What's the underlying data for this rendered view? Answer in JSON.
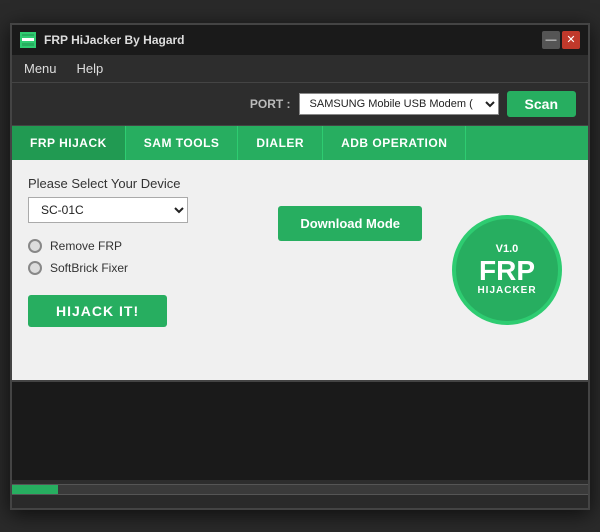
{
  "window": {
    "title": "FRP HiJacker By Hagard",
    "minimize_label": "—",
    "close_label": "✕"
  },
  "menu": {
    "items": [
      {
        "label": "Menu"
      },
      {
        "label": "Help"
      }
    ]
  },
  "port_bar": {
    "label": "PORT :",
    "port_value": "SAMSUNG Mobile USB Modem (",
    "scan_label": "Scan"
  },
  "tabs": [
    {
      "label": "FRP HIJACK",
      "active": true
    },
    {
      "label": "SAM TOOLS"
    },
    {
      "label": "DIALER"
    },
    {
      "label": "ADB OPERATION"
    }
  ],
  "main": {
    "device_label": "Please Select Your Device",
    "device_value": "SC-01C",
    "download_mode_label": "Download Mode",
    "radio_options": [
      {
        "label": "Remove FRP"
      },
      {
        "label": "SoftBrick Fixer"
      }
    ],
    "hijack_label": "HIJACK IT!"
  },
  "logo": {
    "version": "V1.0",
    "title": "FRP",
    "subtitle": "HIJACKER"
  },
  "progress": {
    "fill_percent": 8
  }
}
